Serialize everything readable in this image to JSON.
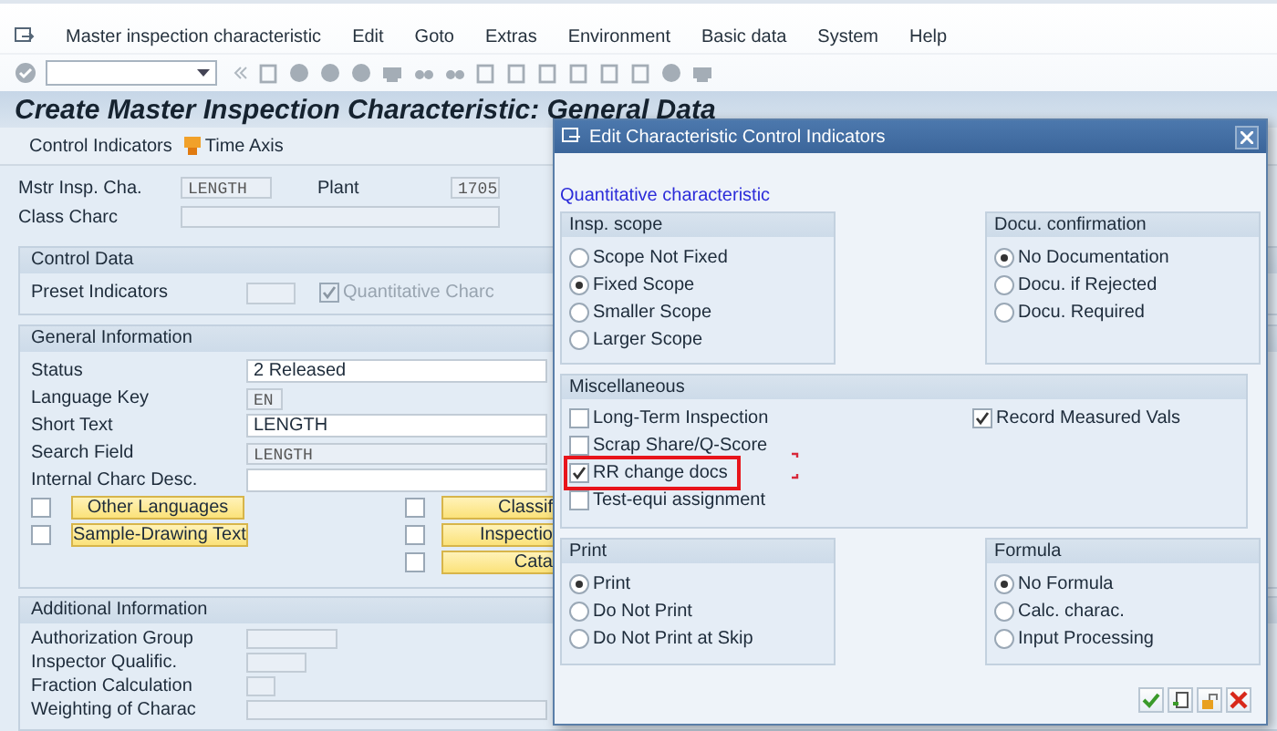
{
  "menu": [
    "Master inspection characteristic",
    "Edit",
    "Goto",
    "Extras",
    "Environment",
    "Basic data",
    "System",
    "Help"
  ],
  "title": "Create Master Inspection Characteristic: General Data",
  "app_toolbar": [
    "Control Indicators",
    "Time Axis"
  ],
  "header_fields": [
    {
      "label": "Mstr Insp. Cha.",
      "value": "LENGTH"
    },
    {
      "label": "Plant",
      "value": "1705"
    },
    {
      "label": "Class Charc"
    }
  ],
  "control_data": {
    "title": "Control Data",
    "label": "Preset Indicators",
    "checkbox": {
      "label": "Quantitative Charc",
      "checked": true,
      "disabled": true
    }
  },
  "general_information": {
    "title": "General Information",
    "fields": [
      {
        "label": "Status",
        "value": "2 Released",
        "kind": "input"
      },
      {
        "label": "Language Key",
        "value": "EN",
        "kind": "display"
      },
      {
        "label": "Short Text",
        "value": "LENGTH",
        "kind": "input"
      },
      {
        "label": "Search Field",
        "value": "LENGTH",
        "kind": "display"
      },
      {
        "label": "Internal Charc Desc.",
        "kind": "input"
      }
    ],
    "left_buttons": [
      {
        "label": "Other Languages",
        "checked": false
      },
      {
        "label": "Sample-Drawing Text",
        "checked": false
      }
    ],
    "right_buttons": [
      {
        "label": "Classif",
        "checked": false
      },
      {
        "label": "Inspectio",
        "checked": false
      },
      {
        "label": "Cata",
        "checked": false
      }
    ]
  },
  "additional_information": {
    "title": "Additional Information",
    "fields": [
      {
        "label": "Authorization Group"
      },
      {
        "label": "Inspector Qualific."
      },
      {
        "label": "Fraction Calculation"
      },
      {
        "label": "Weighting of Charac"
      }
    ]
  },
  "dialog": {
    "title": "Edit Characteristic Control Indicators",
    "subtitle": "Quantitative characteristic",
    "insp_scope": {
      "title": "Insp. scope",
      "options": [
        {
          "label": "Scope Not Fixed",
          "selected": false
        },
        {
          "label": "Fixed Scope",
          "selected": true
        },
        {
          "label": "Smaller Scope",
          "selected": false
        },
        {
          "label": "Larger Scope",
          "selected": false
        }
      ]
    },
    "docu_confirmation": {
      "title": "Docu. confirmation",
      "options": [
        {
          "label": "No Documentation",
          "selected": true
        },
        {
          "label": "Docu. if Rejected",
          "selected": false
        },
        {
          "label": "Docu. Required",
          "selected": false
        }
      ]
    },
    "miscellaneous": {
      "title": "Miscellaneous",
      "left": [
        {
          "label": "Long-Term Inspection",
          "checked": false,
          "highlighted": false
        },
        {
          "label": "Scrap Share/Q-Score",
          "checked": false,
          "highlighted": false
        },
        {
          "label": "RR change docs",
          "checked": true,
          "highlighted": true
        },
        {
          "label": "Test-equi assignment",
          "checked": false,
          "highlighted": false
        }
      ],
      "right": [
        {
          "label": "Record Measured Vals",
          "checked": true,
          "highlighted": false
        }
      ]
    },
    "print": {
      "title": "Print",
      "options": [
        {
          "label": "Print",
          "selected": true
        },
        {
          "label": "Do Not Print",
          "selected": false
        },
        {
          "label": "Do Not Print at Skip",
          "selected": false
        }
      ]
    },
    "formula": {
      "title": "Formula",
      "options": [
        {
          "label": "No Formula",
          "selected": true
        },
        {
          "label": "Calc. charac.",
          "selected": false
        },
        {
          "label": "Input Processing",
          "selected": false
        }
      ]
    }
  }
}
